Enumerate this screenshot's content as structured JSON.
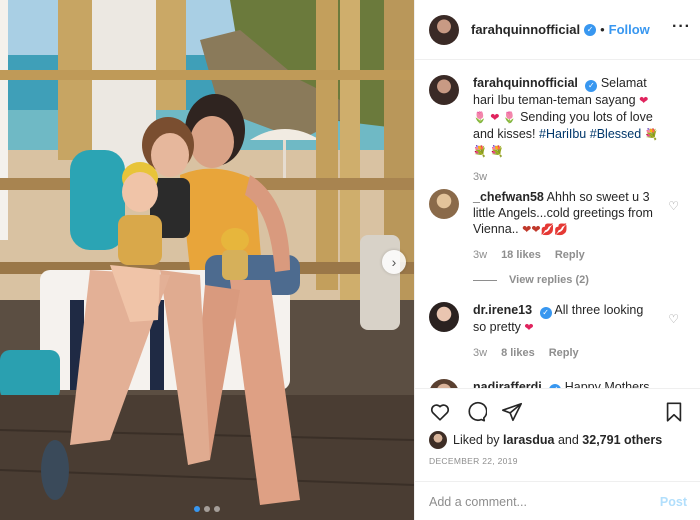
{
  "colors": {
    "accent": "#3897f0",
    "muted": "#8e8e8e",
    "heart": "#e0245e"
  },
  "photo": {
    "alt_icon": "photo",
    "slide_count": 3,
    "active_slide": 1
  },
  "header": {
    "username": "farahquinnofficial",
    "separator": "•",
    "follow_label": "Follow",
    "more_label": "···"
  },
  "caption": {
    "username": "farahquinnofficial",
    "text_1": "Selamat hari Ibu teman-teman sayang",
    "emoji_1": "❤ 🌷 ❤ 🌷",
    "text_2": "Sending you lots of love and kisses!",
    "hashtag_1": "#HariIbu",
    "hashtag_2": "#Blessed",
    "emoji_2": "💐 💐 💐",
    "time": "3w"
  },
  "comments": [
    {
      "username": "_chefwan58",
      "text": "Ahhh so sweet u 3 little Angels...cold greetings from Vienna..",
      "emoji": "❤❤💋💋",
      "time": "3w",
      "likes": "18 likes",
      "reply_label": "Reply",
      "view_replies": "View replies (2)"
    },
    {
      "username": "dr.irene13",
      "text": "All three looking so pretty",
      "emoji": "❤",
      "time": "3w",
      "likes": "8 likes",
      "reply_label": "Reply"
    },
    {
      "username": "nadirafferdi",
      "text": "Happy Mothers"
    }
  ],
  "actions": {
    "liked_by_prefix": "Liked by",
    "liked_by_user": "larasdua",
    "liked_by_connector": "and",
    "liked_by_others": "32,791 others",
    "date": "DECEMBER 22, 2019",
    "comment_placeholder": "Add a comment...",
    "post_label": "Post"
  }
}
